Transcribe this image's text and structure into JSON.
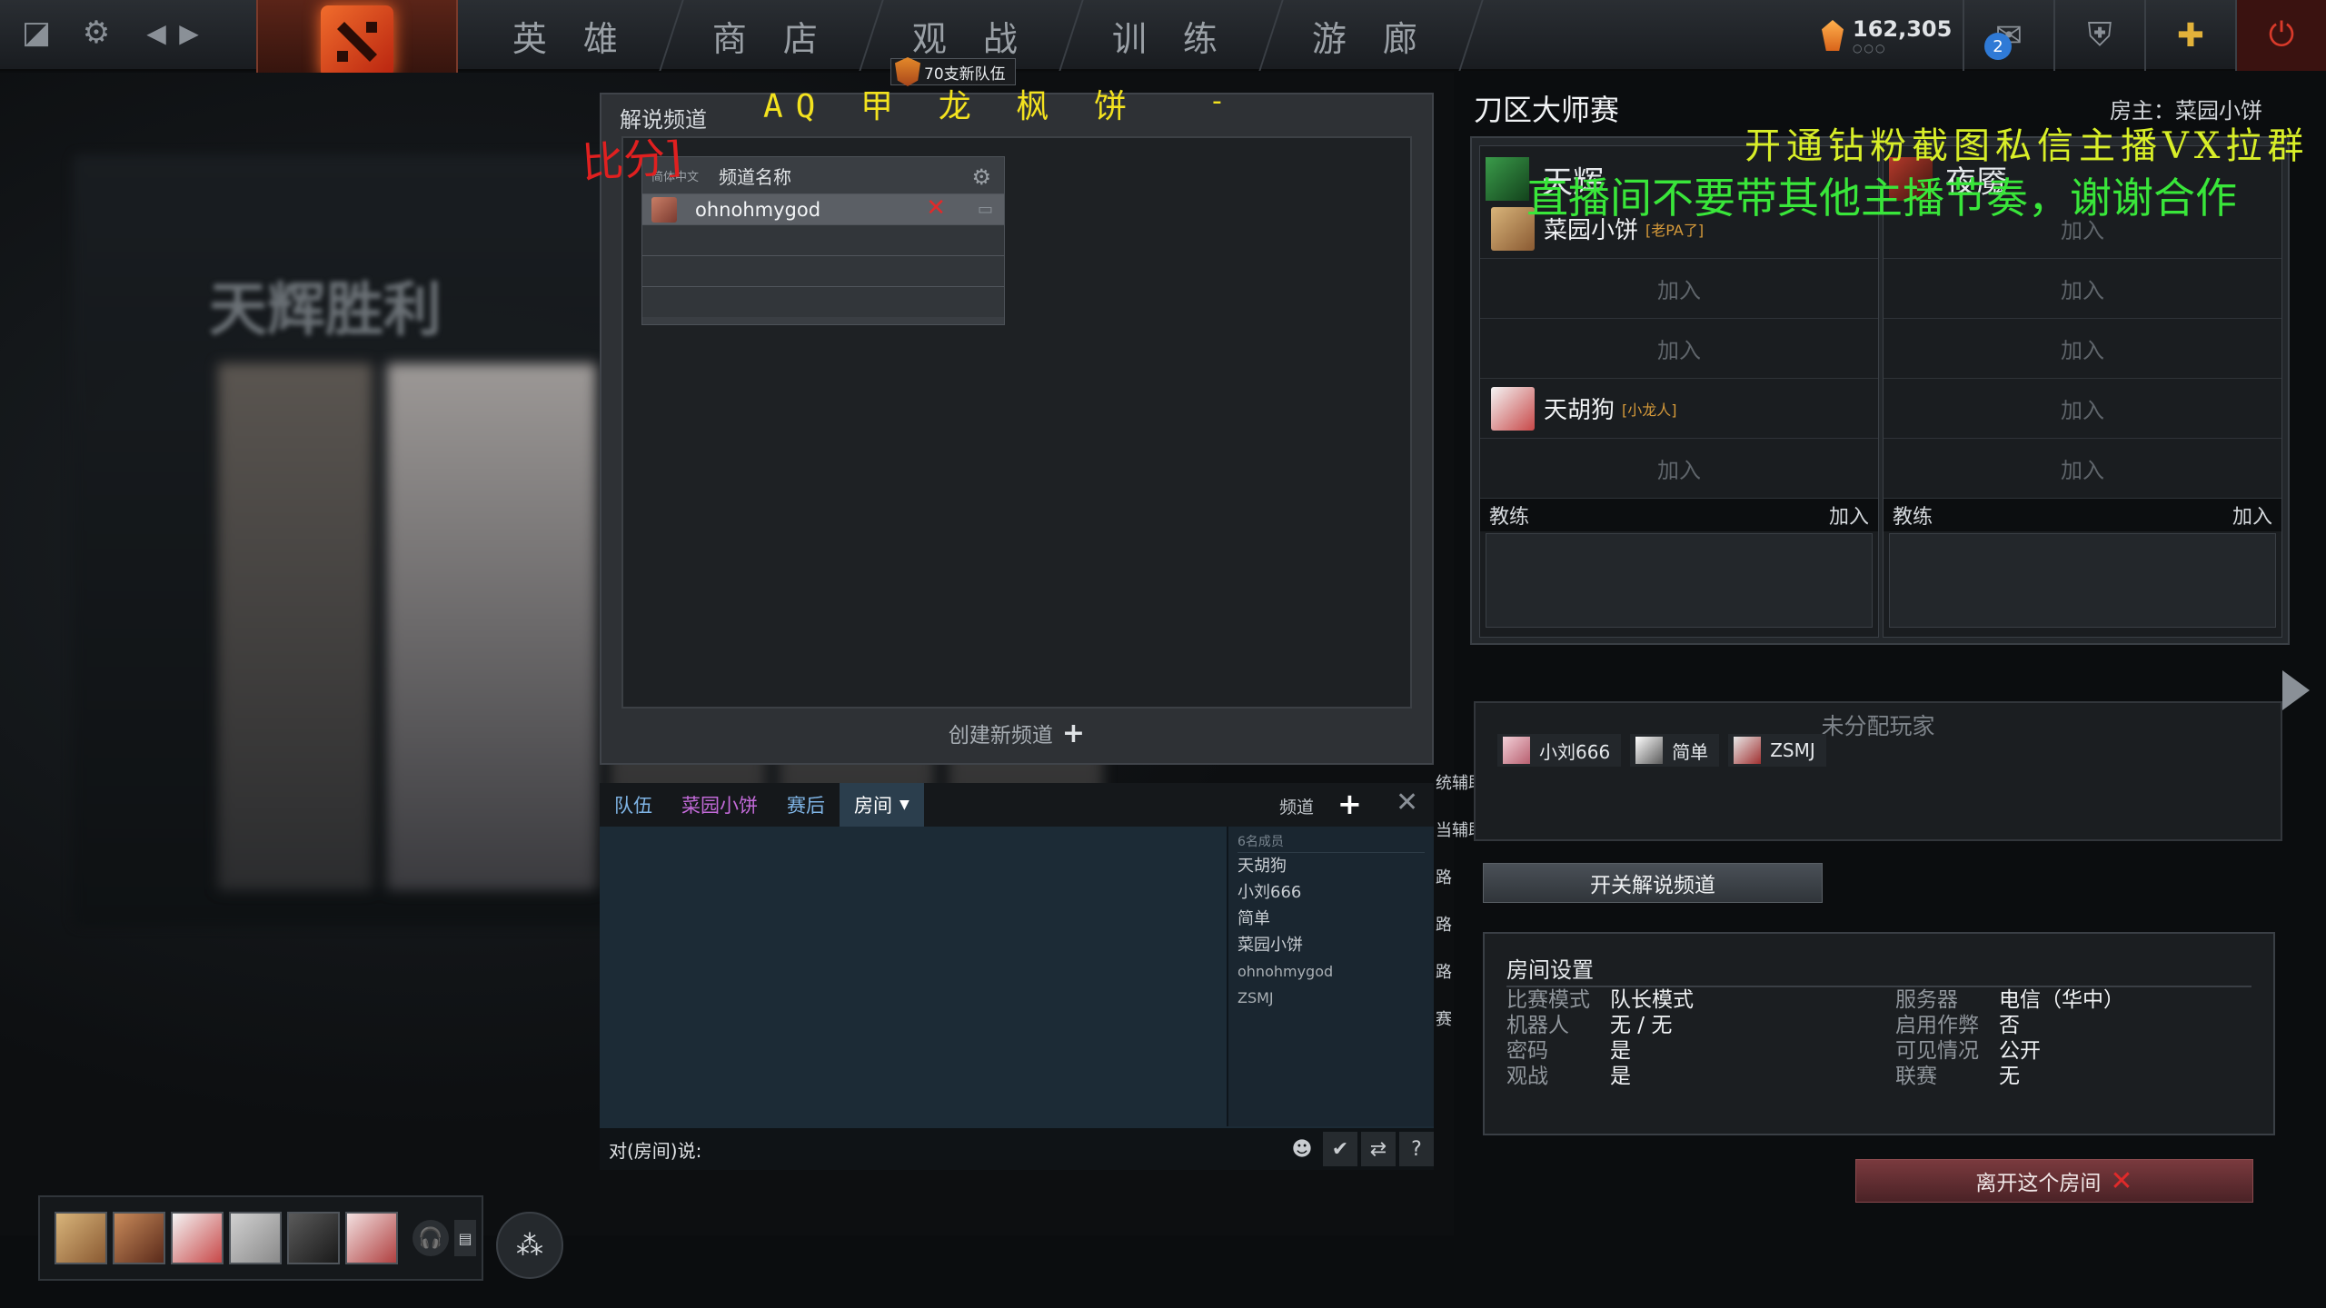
{
  "nav": {
    "items": [
      "英 雄",
      "商 店",
      "观 战",
      "训 练",
      "游 廊"
    ],
    "currency_value": "162,305",
    "currency_dots": "○○○",
    "mail_badge": "2"
  },
  "overlays": {
    "red_text": "比分]",
    "yellow_text": "AQ 甲 龙 枫 饼",
    "yellow_dash": "-",
    "team_badge": "70支新队伍",
    "green_line1": "开通钻粉截图私信主播VX拉群",
    "green_line2": "直播间不要带其他主播节奏，谢谢合作"
  },
  "background": {
    "title": "天辉胜利"
  },
  "channel_panel": {
    "title": "解说频道",
    "header_lang": "简体中文",
    "header_name": "频道名称",
    "channels": [
      {
        "name": "ohnohmygod"
      }
    ],
    "create_label": "创建新频道",
    "create_plus": "+"
  },
  "chat": {
    "tabs": [
      "队伍",
      "菜园小饼",
      "赛后",
      "房间"
    ],
    "channel_label": "频道",
    "plus": "+",
    "close": "✕",
    "member_count": "6名成员",
    "members": [
      "天胡狗",
      "小刘666",
      "简单",
      "菜园小饼",
      "ohnohmygod",
      "ZSMJ"
    ],
    "input_label": "对(房间)说:",
    "help": "?"
  },
  "side_cut": [
    "统辅助",
    "当辅助",
    "路",
    "路",
    "路",
    "赛"
  ],
  "lobby": {
    "title": "刀区大师赛",
    "host": "房主：菜园小饼",
    "radiant_name": "天辉",
    "dire_name": "夜魇",
    "join": "加入",
    "radiant_slots": [
      {
        "name": "菜园小饼",
        "tag": "[老PA了]"
      },
      {
        "name": "",
        "tag": ""
      },
      {
        "name": "",
        "tag": ""
      },
      {
        "name": "天胡狗",
        "tag": "[小龙人]"
      },
      {
        "name": "",
        "tag": ""
      }
    ],
    "coach_label": "教练",
    "coach_join": "加入",
    "unassigned_title": "未分配玩家",
    "unassigned": [
      "小刘666",
      "简单",
      "ZSMJ"
    ],
    "toggle_commentary": "开关解说频道",
    "leave": "离开这个房间",
    "leave_x": "✕"
  },
  "settings": {
    "title": "房间设置",
    "left": [
      {
        "k": "比赛模式",
        "v": "队长模式"
      },
      {
        "k": "机器人",
        "v": "无 / 无"
      },
      {
        "k": "密码",
        "v": "是"
      },
      {
        "k": "观战",
        "v": "是"
      }
    ],
    "right": [
      {
        "k": "服务器",
        "v": "电信（华中）"
      },
      {
        "k": "启用作弊",
        "v": "否"
      },
      {
        "k": "可见情况",
        "v": "公开"
      },
      {
        "k": "联赛",
        "v": "无"
      }
    ]
  },
  "colors": {
    "accent_red": "#e02a2a",
    "overlay_yellow": "#f3e21f",
    "overlay_green": "#39e63a",
    "chat_link": "#7fb4e5",
    "chat_purple": "#c26ad8"
  }
}
